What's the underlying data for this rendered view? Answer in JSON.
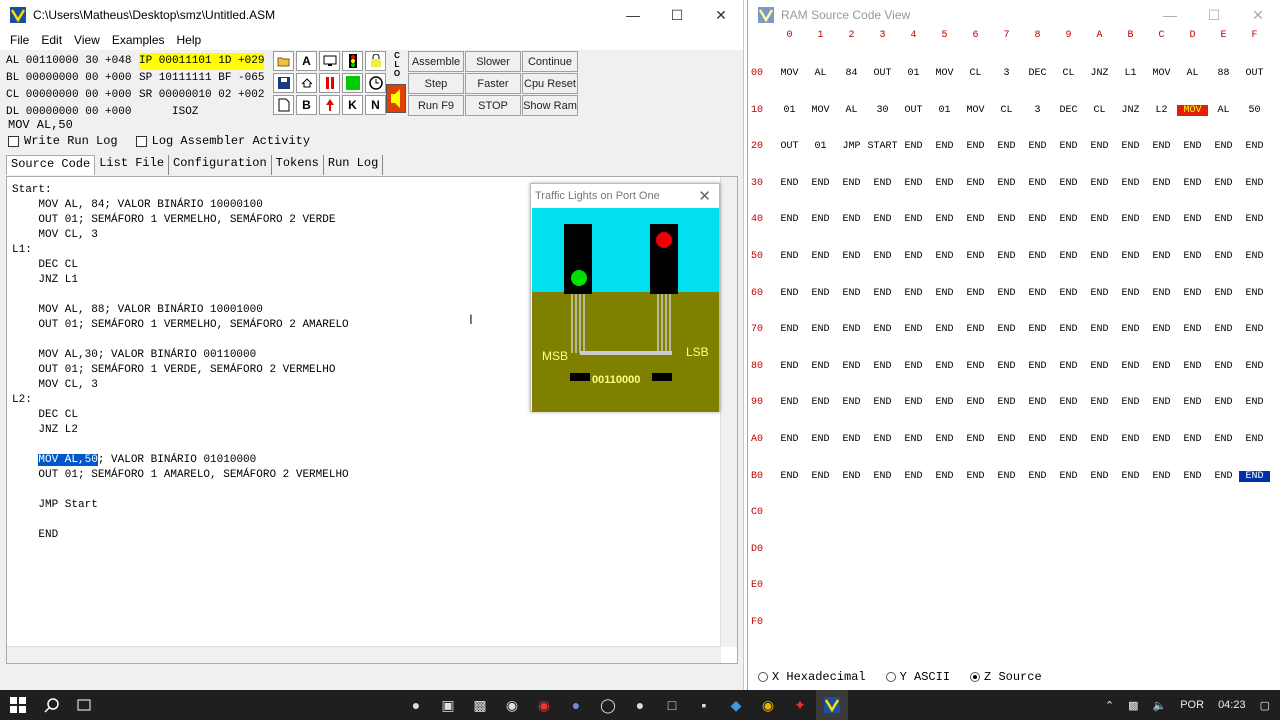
{
  "editor_window": {
    "title": "C:\\Users\\Matheus\\Desktop\\smz\\Untitled.ASM",
    "menu": [
      "File",
      "Edit",
      "View",
      "Examples",
      "Help"
    ],
    "registers_left": [
      "AL 00110000 30 +048",
      "BL 00000000 00 +000",
      "CL 00000000 00 +000",
      "DL 00000000 00 +000"
    ],
    "registers_right": [
      "IP 00011101 1D +029",
      "SP 10111111 BF -065",
      "SR 00000010 02 +002",
      "     ISOZ"
    ],
    "toolbar_icons": [
      "open-folder-icon",
      "A",
      "monitor-icon",
      "traffic-light-icon",
      "lock-icon",
      "save-icon",
      "home-icon",
      "thermometer-icon",
      "green-square-icon",
      "clock-icon",
      "new-file-icon",
      "B",
      "up-arrow-icon",
      "K",
      "N"
    ],
    "clo_label": "C\nL\nO",
    "buttons": [
      [
        "Assemble",
        "Slower",
        "Continue"
      ],
      [
        "Step",
        "Faster",
        "Cpu Reset"
      ],
      [
        "Run F9",
        "STOP",
        "Show Ram"
      ]
    ],
    "current_line": "MOV AL,50",
    "write_run_log": "Write Run Log",
    "log_assembler": "Log Assembler Activity",
    "tabs": [
      "Source Code",
      "List File",
      "Configuration",
      "Tokens",
      "Run Log"
    ],
    "code_before": "Start:\n    MOV AL, 84; VALOR BINÁRIO 10000100\n    OUT 01; SEMÁFORO 1 VERMELHO, SEMÁFORO 2 VERDE\n    MOV CL, 3\nL1:\n    DEC CL\n    JNZ L1\n\n    MOV AL, 88; VALOR BINÁRIO 10001000\n    OUT 01; SEMÁFORO 1 VERMELHO, SEMÁFORO 2 AMARELO\n\n    MOV AL,30; VALOR BINÁRIO 00110000\n    OUT 01; SEMÁFORO 1 VERDE, SEMÁFORO 2 VERMELHO\n    MOV CL, 3\nL2:\n    DEC CL\n    JNZ L2\n\n    ",
    "code_selected": "MOV AL,50",
    "code_after": "; VALOR BINÁRIO 01010000\n    OUT 01; SEMÁFORO 1 AMARELO, SEMÁFORO 2 VERMELHO\n\n    JMP Start\n\n    END"
  },
  "traffic_window": {
    "title": "Traffic Lights on Port One",
    "msb": "MSB",
    "lsb": "LSB",
    "port_value": "00110000",
    "colors": {
      "sky": "#00e0f0",
      "ground": "#7f7f00",
      "green": "#00e000",
      "red": "#f00000"
    }
  },
  "ram_window": {
    "title": "RAM Source Code View",
    "col_headers": [
      "0",
      "1",
      "2",
      "3",
      "4",
      "5",
      "6",
      "7",
      "8",
      "9",
      "A",
      "B",
      "C",
      "D",
      "E",
      "F"
    ],
    "row_labels": [
      "00",
      "10",
      "20",
      "30",
      "40",
      "50",
      "60",
      "70",
      "80",
      "90",
      "A0",
      "B0",
      "C0",
      "D0",
      "E0",
      "F0"
    ],
    "rows": [
      [
        "MOV",
        "AL",
        "84",
        "OUT",
        "01",
        "MOV",
        "CL",
        "3",
        "DEC",
        "CL",
        "JNZ",
        "L1",
        "MOV",
        "AL",
        "88",
        "OUT"
      ],
      [
        "01",
        "MOV",
        "AL",
        "30",
        "OUT",
        "01",
        "MOV",
        "CL",
        "3",
        "DEC",
        "CL",
        "JNZ",
        "L2",
        "MOV",
        "AL",
        "50"
      ],
      [
        "OUT",
        "01",
        "JMP",
        "START",
        "END",
        "END",
        "END",
        "END",
        "END",
        "END",
        "END",
        "END",
        "END",
        "END",
        "END",
        "END"
      ],
      [
        "END",
        "END",
        "END",
        "END",
        "END",
        "END",
        "END",
        "END",
        "END",
        "END",
        "END",
        "END",
        "END",
        "END",
        "END",
        "END"
      ],
      [
        "END",
        "END",
        "END",
        "END",
        "END",
        "END",
        "END",
        "END",
        "END",
        "END",
        "END",
        "END",
        "END",
        "END",
        "END",
        "END"
      ],
      [
        "END",
        "END",
        "END",
        "END",
        "END",
        "END",
        "END",
        "END",
        "END",
        "END",
        "END",
        "END",
        "END",
        "END",
        "END",
        "END"
      ],
      [
        "END",
        "END",
        "END",
        "END",
        "END",
        "END",
        "END",
        "END",
        "END",
        "END",
        "END",
        "END",
        "END",
        "END",
        "END",
        "END"
      ],
      [
        "END",
        "END",
        "END",
        "END",
        "END",
        "END",
        "END",
        "END",
        "END",
        "END",
        "END",
        "END",
        "END",
        "END",
        "END",
        "END"
      ],
      [
        "END",
        "END",
        "END",
        "END",
        "END",
        "END",
        "END",
        "END",
        "END",
        "END",
        "END",
        "END",
        "END",
        "END",
        "END",
        "END"
      ],
      [
        "END",
        "END",
        "END",
        "END",
        "END",
        "END",
        "END",
        "END",
        "END",
        "END",
        "END",
        "END",
        "END",
        "END",
        "END",
        "END"
      ],
      [
        "END",
        "END",
        "END",
        "END",
        "END",
        "END",
        "END",
        "END",
        "END",
        "END",
        "END",
        "END",
        "END",
        "END",
        "END",
        "END"
      ],
      [
        "END",
        "END",
        "END",
        "END",
        "END",
        "END",
        "END",
        "END",
        "END",
        "END",
        "END",
        "END",
        "END",
        "END",
        "END",
        "END"
      ],
      [],
      [],
      [],
      []
    ],
    "radios": [
      "X Hexadecimal",
      "Y ASCII",
      "Z Source"
    ],
    "selected_radio": "Z Source"
  },
  "taskbar": {
    "language": "POR",
    "time": "04:23"
  }
}
